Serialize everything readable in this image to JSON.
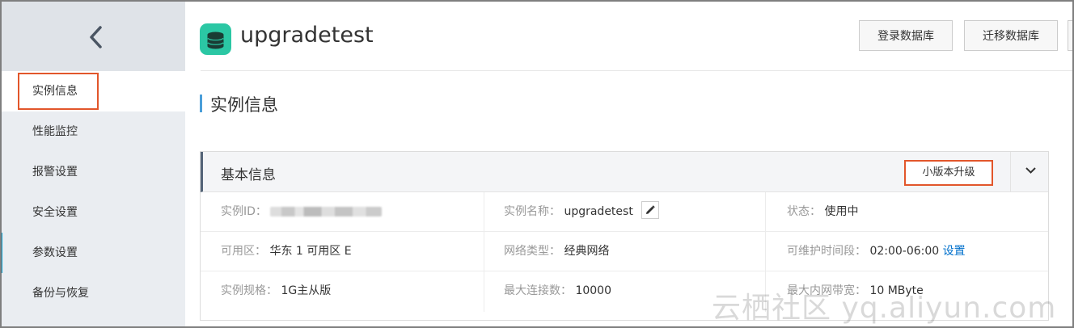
{
  "sidebar": {
    "back_icon": "chevron-left-icon",
    "items": [
      {
        "label": "实例信息"
      },
      {
        "label": "性能监控"
      },
      {
        "label": "报警设置"
      },
      {
        "label": "安全设置"
      },
      {
        "label": "参数设置"
      },
      {
        "label": "备份与恢复"
      }
    ]
  },
  "header": {
    "logo_icon": "database-stack-icon",
    "title": "upgradetest",
    "buttons": [
      {
        "label": "登录数据库"
      },
      {
        "label": "迁移数据库"
      }
    ]
  },
  "section": {
    "title": "实例信息"
  },
  "panel": {
    "title": "基本信息",
    "upgrade_label": "小版本升级",
    "collapse_icon": "chevron-down-icon",
    "rows": [
      [
        {
          "label": "实例ID：",
          "value": ""
        },
        {
          "label": "实例名称：",
          "value": "upgradetest"
        },
        {
          "label": "状态：",
          "value": "使用中"
        }
      ],
      [
        {
          "label": "可用区：",
          "value": "华东 1 可用区 E"
        },
        {
          "label": "网络类型：",
          "value": "经典网络"
        },
        {
          "label": "可维护时间段：",
          "value": "02:00-06:00",
          "link": "设置"
        }
      ],
      [
        {
          "label": "实例规格：",
          "value": "1G主从版"
        },
        {
          "label": "最大连接数：",
          "value": "10000"
        },
        {
          "label": "最大内网带宽：",
          "value": "10 MByte"
        }
      ]
    ]
  },
  "watermark": "云栖社区 yq.aliyun.com",
  "colors": {
    "accent": "#e2562b",
    "status_ok": "#1da02b",
    "link": "#0070cc",
    "logo": "#2bc7a4"
  }
}
